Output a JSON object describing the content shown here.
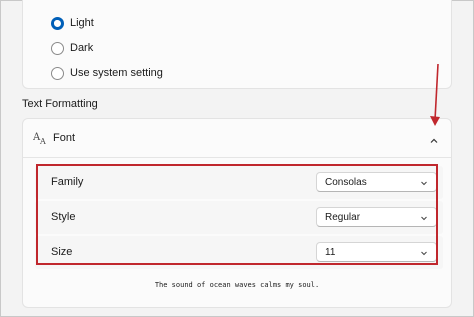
{
  "theme": {
    "options": [
      {
        "label": "Light",
        "checked": true
      },
      {
        "label": "Dark",
        "checked": false
      },
      {
        "label": "Use system setting",
        "checked": false
      }
    ]
  },
  "text_formatting": {
    "section_label": "Text Formatting",
    "font": {
      "title": "Font",
      "icon": "font-icon",
      "expanded": true,
      "settings": [
        {
          "label": "Family",
          "value": "Consolas"
        },
        {
          "label": "Style",
          "value": "Regular"
        },
        {
          "label": "Size",
          "value": "11"
        }
      ],
      "preview": "The sound of ocean waves calms my soul."
    }
  },
  "annotation": {
    "color": "#c0272d"
  },
  "colors": {
    "accent": "#005fb8",
    "highlight": "#c0272d"
  }
}
